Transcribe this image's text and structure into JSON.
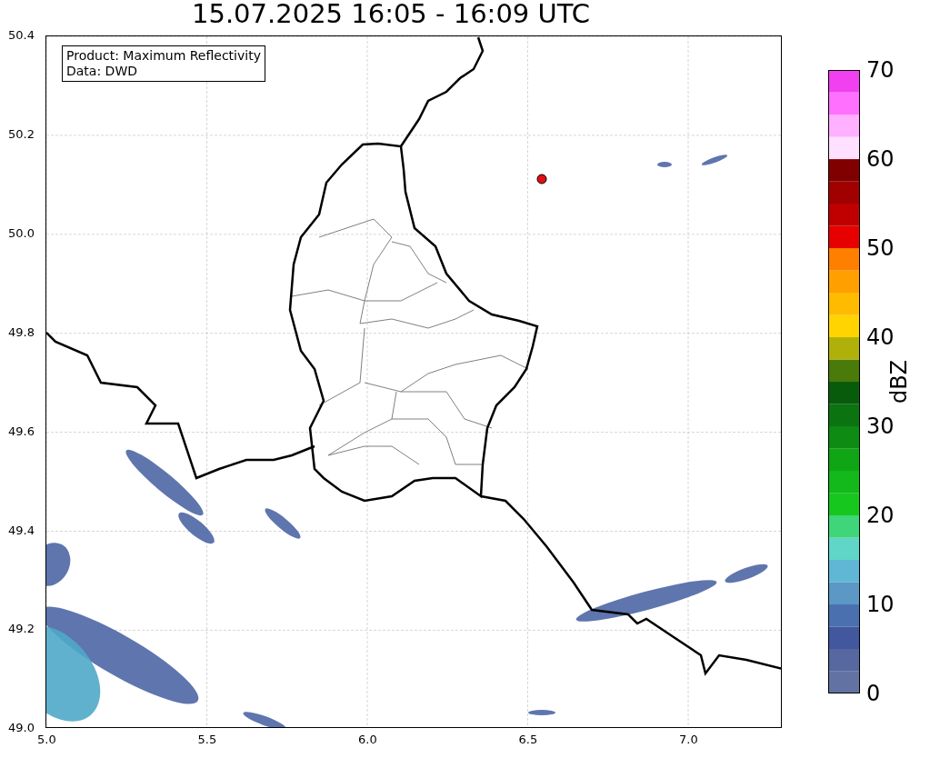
{
  "title": "15.07.2025 16:05 - 16:09 UTC",
  "legend": [
    "Product: Maximum Reflectivity",
    "Data: DWD"
  ],
  "x_ticks": [
    "5.0",
    "5.5",
    "6.0",
    "6.5",
    "7.0"
  ],
  "y_ticks": [
    "50.4",
    "50.2",
    "50.0",
    "49.8",
    "49.6",
    "49.4",
    "49.2",
    "49.0"
  ],
  "colorbar": {
    "label": "dBZ",
    "ticks": [
      "70",
      "60",
      "50",
      "40",
      "30",
      "20",
      "10",
      "0"
    ]
  }
}
